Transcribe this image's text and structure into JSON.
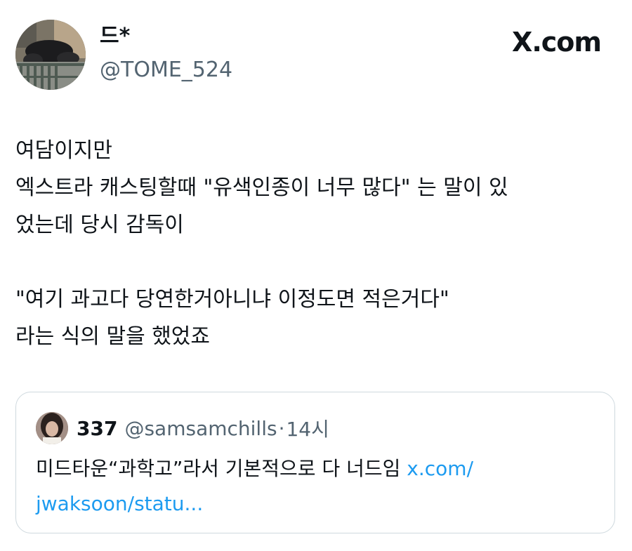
{
  "author": {
    "display_name": "드*",
    "handle": "@TOME_524"
  },
  "brand": {
    "label": "X.com"
  },
  "tweet": {
    "lines": [
      "여담이지만",
      "엑스트라 캐스팅할때 \"유색인종이 너무 많다\" 는 말이 있",
      "었는데 당시 감독이",
      "",
      "\"여기 과고다 당연한거아니냐 이정도면 적은거다\"",
      "라는 식의 말을 했었죠"
    ]
  },
  "quoted_tweet": {
    "display_name": "337",
    "handle": "@samsamchills",
    "separator": "·",
    "time": "14시",
    "text": "미드타운“과학고”라서 기본적으로 다 너드임 ",
    "link_line1": "x.com/",
    "link_line2": "jwaksoon/statu..."
  },
  "colors": {
    "text_primary": "#0f1419",
    "text_secondary": "#536471",
    "link": "#1d9bf0",
    "card_border": "#cfd9de"
  }
}
